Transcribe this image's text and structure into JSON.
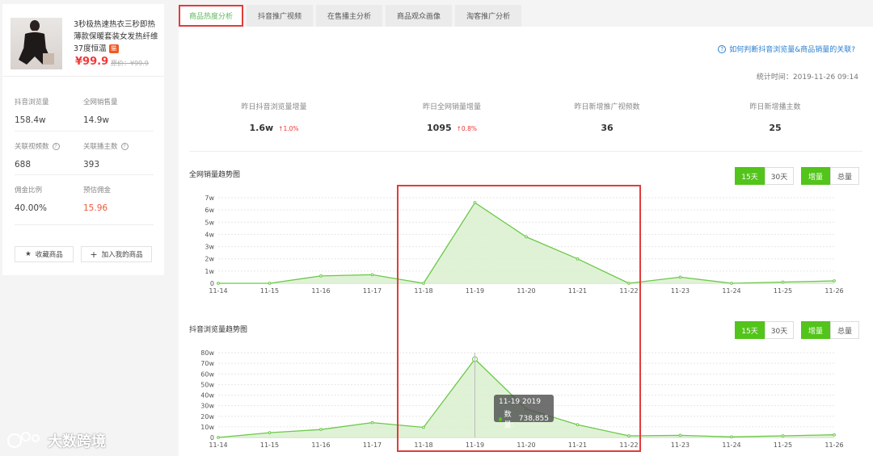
{
  "product": {
    "title": "3秒极热速热衣三秒即热薄款保暖套装女发热纤维37度恒温",
    "badge": "猫",
    "price": "¥99.9",
    "orig_price": "原价：¥99.9"
  },
  "stats": [
    {
      "label": "抖音浏览量",
      "value": "158.4w",
      "help": false
    },
    {
      "label": "全网销售量",
      "value": "14.9w",
      "help": false
    },
    {
      "label": "关联视频数",
      "value": "688",
      "help": true
    },
    {
      "label": "关联播主数",
      "value": "393",
      "help": true
    },
    {
      "label": "佣金比例",
      "value": "40.00%",
      "help": false
    },
    {
      "label": "预估佣金",
      "value": "15.96",
      "help": false
    }
  ],
  "actions": {
    "favorite": "收藏商品",
    "add": "加入我的商品"
  },
  "tabs": [
    "商品热度分析",
    "抖音推广视频",
    "在售播主分析",
    "商品观众画像",
    "淘客推广分析"
  ],
  "help_link": "如何判断抖音浏览量&商品销量的关联?",
  "stat_time": "统计时间：2019-11-26 09:14",
  "kpis": [
    {
      "label": "昨日抖音浏览量增量",
      "value": "1.6w",
      "delta": "↑1.0%"
    },
    {
      "label": "昨日全网销量增量",
      "value": "1095",
      "delta": "↑0.8%"
    },
    {
      "label": "昨日新增推广视频数",
      "value": "36",
      "delta": ""
    },
    {
      "label": "昨日新增播主数",
      "value": "25",
      "delta": ""
    }
  ],
  "controls": {
    "d15": "15天",
    "d30": "30天",
    "inc": "增量",
    "total": "总量"
  },
  "tooltip": {
    "title": "11-19 2019",
    "label": "数量:",
    "value": "738,855"
  },
  "watermark": "大数跨境",
  "colors": {
    "accent": "#52c41a",
    "line": "#6cc84a",
    "fill": "#d9f0cf",
    "highlight": "#e03c3c"
  },
  "chart_data": [
    {
      "type": "area",
      "title": "全网销量趋势图",
      "x": [
        "11-14",
        "11-15",
        "11-16",
        "11-17",
        "11-18",
        "11-19",
        "11-20",
        "11-21",
        "11-22",
        "11-23",
        "11-24",
        "11-25",
        "11-26"
      ],
      "series": [
        {
          "values": [
            0,
            0,
            0.6,
            0.7,
            0,
            6.6,
            3.8,
            2.0,
            0,
            0.5,
            0,
            0.1,
            0.2
          ]
        }
      ],
      "y_ticks": [
        "0",
        "1w",
        "2w",
        "3w",
        "4w",
        "5w",
        "6w",
        "7w"
      ],
      "ylim": [
        0,
        7
      ],
      "grid": true
    },
    {
      "type": "area",
      "title": "抖音浏览量趋势图",
      "x": [
        "11-14",
        "11-15",
        "11-16",
        "11-17",
        "11-18",
        "11-19",
        "11-20",
        "11-21",
        "11-22",
        "11-23",
        "11-24",
        "11-25",
        "11-26"
      ],
      "series": [
        {
          "values": [
            0,
            4.5,
            7.5,
            14,
            9.5,
            73.9,
            27,
            12,
            1.5,
            2,
            0.5,
            1.5,
            2.5
          ]
        }
      ],
      "y_ticks": [
        "0",
        "10w",
        "20w",
        "30w",
        "40w",
        "50w",
        "60w",
        "70w",
        "80w"
      ],
      "ylim": [
        0,
        80
      ],
      "grid": true
    }
  ]
}
